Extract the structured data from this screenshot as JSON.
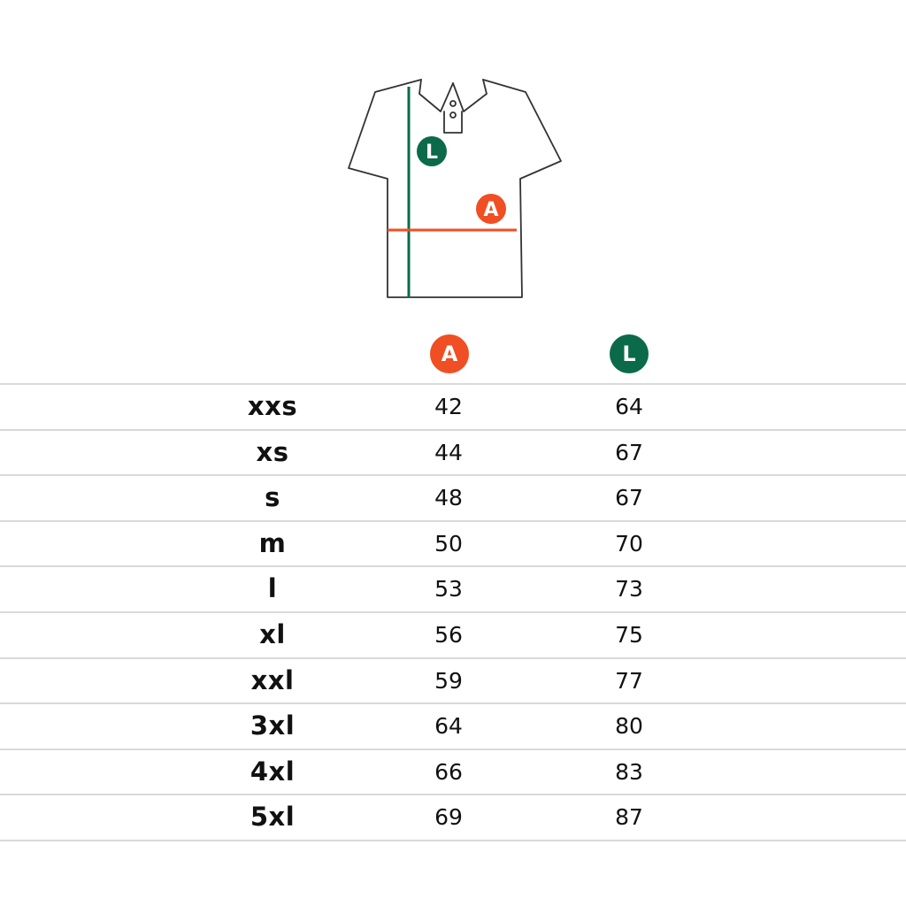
{
  "colors": {
    "accent_a": "#f04e23",
    "accent_l": "#0b6a4a"
  },
  "illustration": {
    "badge_l": "L",
    "badge_a": "A"
  },
  "header": {
    "a_label": "A",
    "l_label": "L"
  },
  "rows": [
    {
      "size": "xxs",
      "a": "42",
      "l": "64"
    },
    {
      "size": "xs",
      "a": "44",
      "l": "67"
    },
    {
      "size": "s",
      "a": "48",
      "l": "67"
    },
    {
      "size": "m",
      "a": "50",
      "l": "70"
    },
    {
      "size": "l",
      "a": "53",
      "l": "73"
    },
    {
      "size": "xl",
      "a": "56",
      "l": "75"
    },
    {
      "size": "xxl",
      "a": "59",
      "l": "77"
    },
    {
      "size": "3xl",
      "a": "64",
      "l": "80"
    },
    {
      "size": "4xl",
      "a": "66",
      "l": "83"
    },
    {
      "size": "5xl",
      "a": "69",
      "l": "87"
    }
  ]
}
